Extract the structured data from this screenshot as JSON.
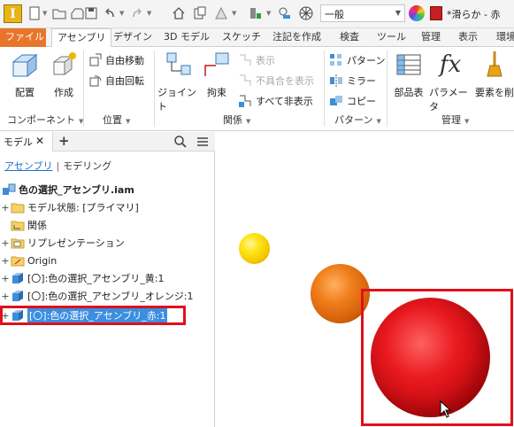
{
  "quick_access": {
    "standard_value": "一般",
    "appearance_value": "*滑らか - 赤"
  },
  "tabs": [
    {
      "label": "ファイル"
    },
    {
      "label": "アセンブリ"
    },
    {
      "label": "デザイン"
    },
    {
      "label": "3D モデル"
    },
    {
      "label": "スケッチ"
    },
    {
      "label": "注記を作成"
    },
    {
      "label": "検査"
    },
    {
      "label": "ツール"
    },
    {
      "label": "管理"
    },
    {
      "label": "表示"
    },
    {
      "label": "環境"
    }
  ],
  "ribbon": {
    "component": {
      "place_label": "配置",
      "create_label": "作成",
      "panel_label": "コンポーネント"
    },
    "position": {
      "free_move_label": "自由移動",
      "free_rotate_label": "自由回転",
      "panel_label": "位置"
    },
    "relationships": {
      "joint_label": "ジョイント",
      "constrain_label": "拘束",
      "show_label": "表示",
      "show_sick_label": "不具合を表示",
      "hide_all_label": "すべて非表示",
      "panel_label": "関係"
    },
    "pattern": {
      "pattern_label": "パターン",
      "mirror_label": "ミラー",
      "copy_label": "コピー",
      "panel_label": "パターン"
    },
    "manage": {
      "bom_label": "部品表",
      "parameters_label": "パラメータ",
      "delete_label": "要素を削",
      "panel_label": "管理"
    }
  },
  "browser": {
    "tab_label": "モデル",
    "subtab_assembly": "アセンブリ",
    "subtab_modeling": "モデリング",
    "tree": [
      {
        "label": "色の選択_アセンブリ.iam"
      },
      {
        "label": "モデル状態: [プライマリ]"
      },
      {
        "label": "関係"
      },
      {
        "label": "リプレゼンテーション"
      },
      {
        "label": "Origin"
      },
      {
        "label": "[〇]:色の選択_アセンブリ_黄:1"
      },
      {
        "label": "[〇]:色の選択_アセンブリ_オレンジ:1"
      },
      {
        "label": "[〇]:色の選択_アセンブリ_赤:1"
      }
    ]
  },
  "colors": {
    "file_tab": "#e8752b",
    "selection": "#3b8ee0",
    "annotation": "#e0101a",
    "sphere_yellow": "#ffe51a",
    "sphere_orange": "#f07d1a",
    "sphere_red": "#e81a1f"
  }
}
